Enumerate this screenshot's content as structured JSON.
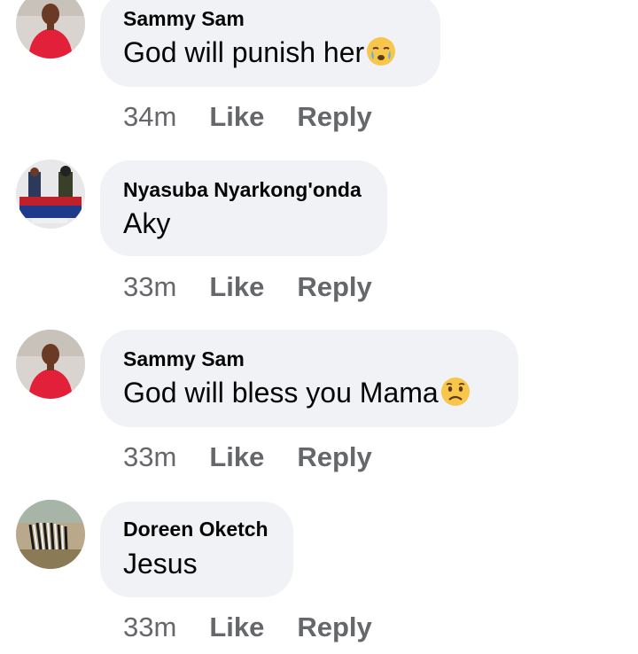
{
  "comments": [
    {
      "author": "Sammy Sam",
      "text": "God will punish her",
      "emoji": "crying-emoji",
      "time": "34m",
      "like": "Like",
      "reply": "Reply",
      "avatar": "profile-photo-man-red-shirt"
    },
    {
      "author": "Nyasuba Nyarkong'onda",
      "text": "Aky",
      "emoji": "",
      "time": "33m",
      "like": "Like",
      "reply": "Reply",
      "avatar": "profile-photo-group-poster"
    },
    {
      "author": "Sammy Sam",
      "text": "God will bless you Mama",
      "emoji": "sad-emoji",
      "time": "33m",
      "like": "Like",
      "reply": "Reply",
      "avatar": "profile-photo-man-red-shirt"
    },
    {
      "author": "Doreen Oketch",
      "text": "Jesus",
      "emoji": "",
      "time": "33m",
      "like": "Like",
      "reply": "Reply",
      "avatar": "profile-photo-zebra"
    }
  ],
  "colors": {
    "bubble": "#f0f2f5",
    "meta": "#65676b",
    "text": "#050505"
  }
}
